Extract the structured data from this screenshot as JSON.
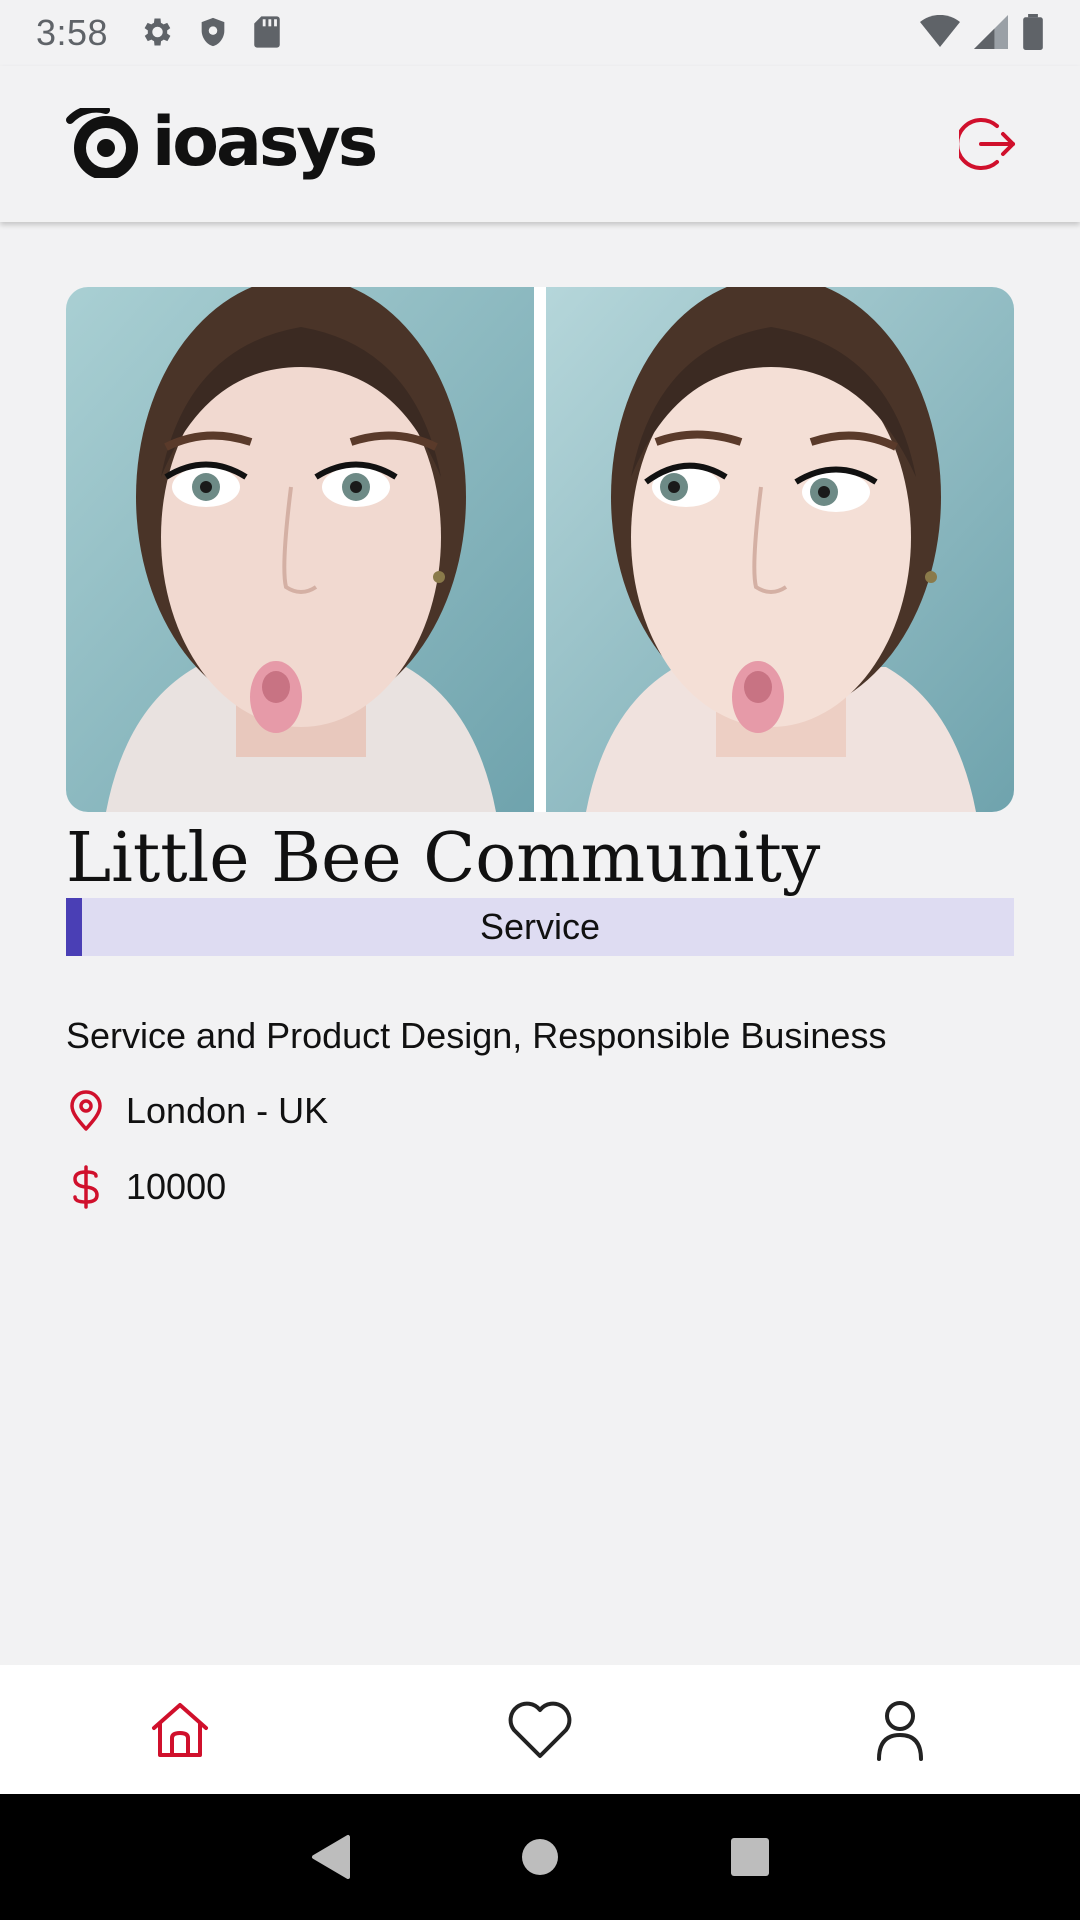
{
  "status_bar": {
    "time": "3:58",
    "left_icons": [
      "settings-icon",
      "shield-icon",
      "sd-card-icon"
    ],
    "right_icons": [
      "wifi-icon",
      "signal-icon",
      "battery-icon"
    ]
  },
  "app_bar": {
    "logo_text": "ioasys",
    "logout_icon": "logout-icon"
  },
  "company": {
    "name": "Little Bee Community",
    "type": "Service",
    "sectors": "Service and Product Design, Responsible Business",
    "location": "London - UK",
    "price": "10000",
    "image_description_icon": "photo"
  },
  "bottom_nav": {
    "items": [
      {
        "icon": "home-icon",
        "active": true
      },
      {
        "icon": "heart-icon",
        "active": false
      },
      {
        "icon": "profile-icon",
        "active": false
      }
    ]
  },
  "colors": {
    "accent": "#d0102c",
    "badge_bg": "#dedcf2",
    "badge_bar": "#4a3fb5",
    "background": "#f2f2f3"
  }
}
